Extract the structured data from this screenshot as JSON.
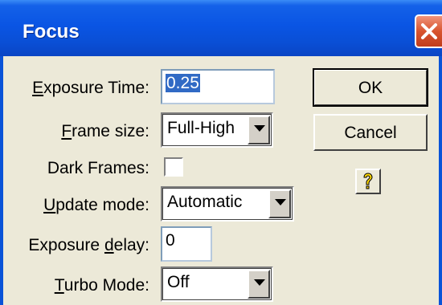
{
  "window": {
    "title": "Focus"
  },
  "form": {
    "exposure_time": {
      "label_mnemonic": "E",
      "label_rest": "xposure Time:",
      "value": "0.25"
    },
    "frame_size": {
      "label_mnemonic": "F",
      "label_rest": "rame size:",
      "selected": "Full-High"
    },
    "dark_frames": {
      "label": "Dark Frames:",
      "checked": false
    },
    "update_mode": {
      "label_mnemonic": "U",
      "label_rest": "pdate mode:",
      "selected": "Automatic"
    },
    "exposure_delay": {
      "label_before": "Exposure ",
      "label_mnemonic": "d",
      "label_after": "elay:",
      "value": "0"
    },
    "turbo_mode": {
      "label_mnemonic": "T",
      "label_rest": "urbo Mode:",
      "selected": "Off"
    }
  },
  "buttons": {
    "ok": "OK",
    "cancel": "Cancel"
  },
  "icons": {
    "close": "close-icon",
    "help": "help-icon",
    "dropdown": "chevron-down-icon"
  },
  "colors": {
    "titlebar": "#0a55e4",
    "close_button": "#d8542e",
    "dialog_bg": "#ece9d8",
    "selection": "#316ac5",
    "help_icon": "#ffd800"
  }
}
